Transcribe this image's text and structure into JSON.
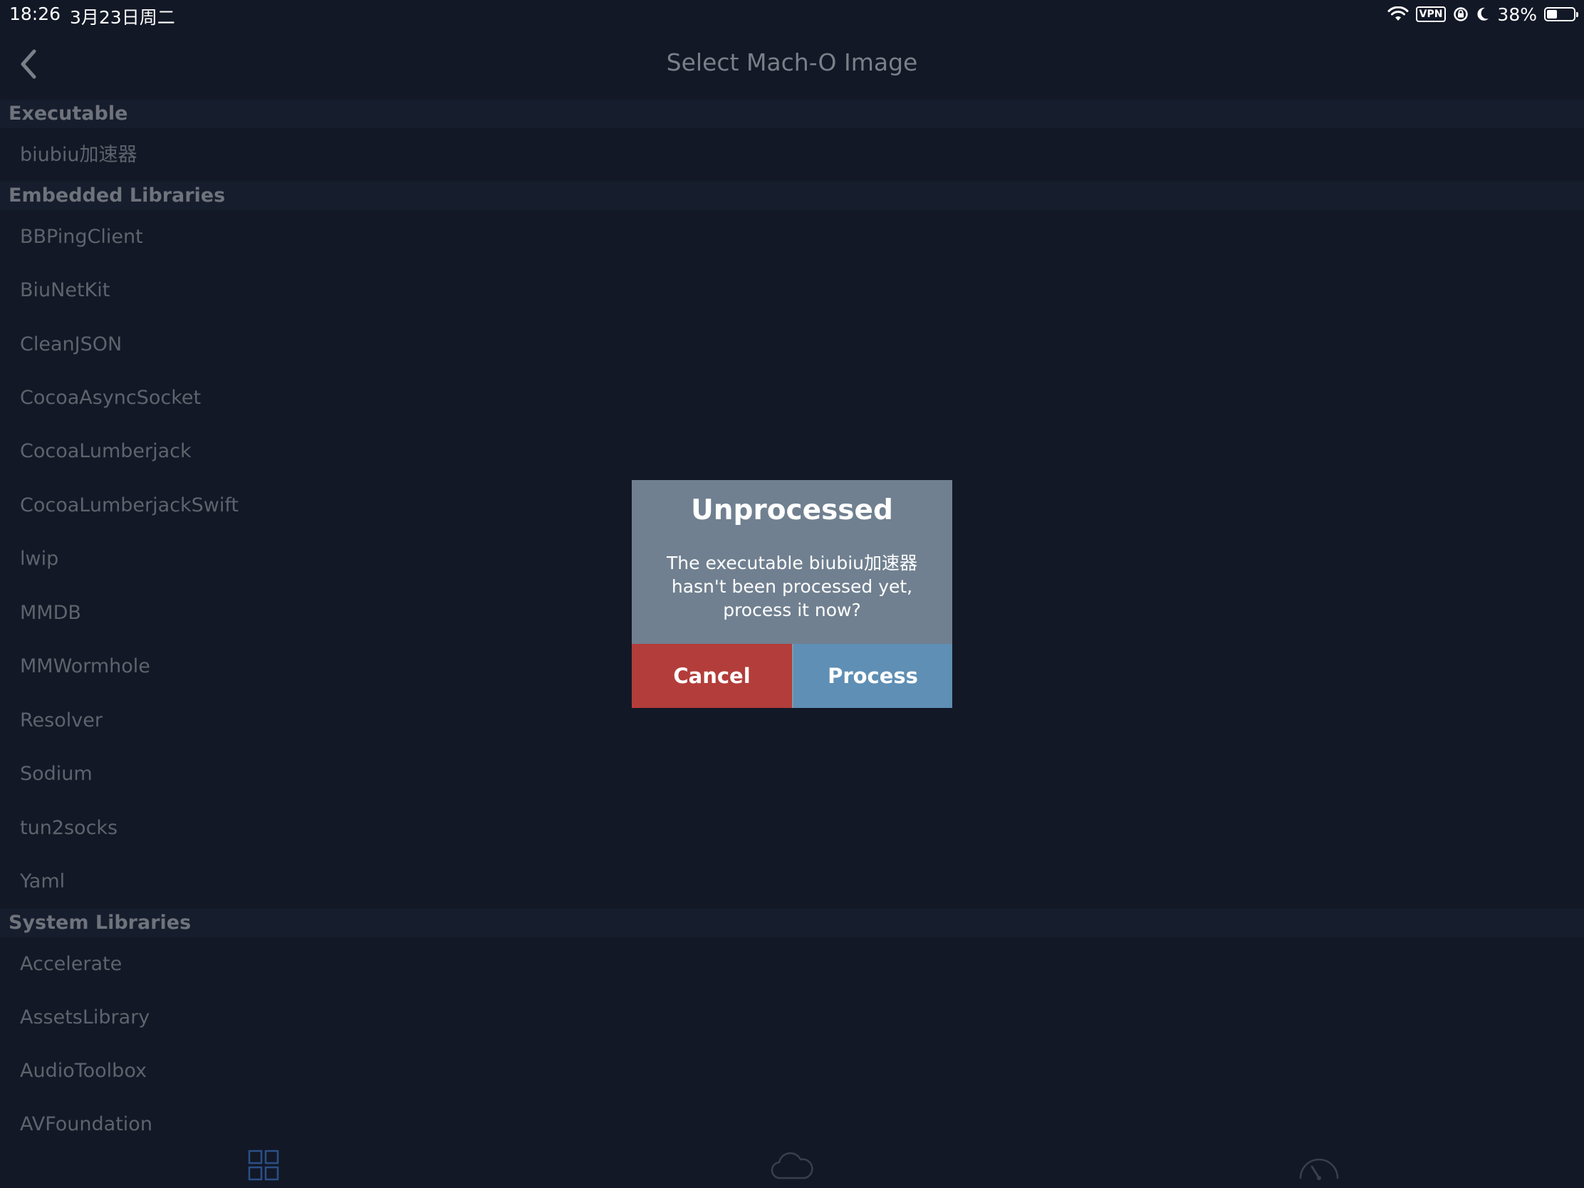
{
  "status_bar": {
    "time": "18:26",
    "date": "3月23日周二",
    "vpn": "VPN",
    "battery": "38%",
    "battery_level": 0.38
  },
  "nav": {
    "title": "Select Mach-O Image"
  },
  "sections": [
    {
      "header": "Executable",
      "items": [
        "biubiu加速器"
      ]
    },
    {
      "header": "Embedded Libraries",
      "items": [
        "BBPingClient",
        "BiuNetKit",
        "CleanJSON",
        "CocoaAsyncSocket",
        "CocoaLumberjack",
        "CocoaLumberjackSwift",
        "lwip",
        "MMDB",
        "MMWormhole",
        "Resolver",
        "Sodium",
        "tun2socks",
        "Yaml"
      ]
    },
    {
      "header": "System Libraries",
      "items": [
        "Accelerate",
        "AssetsLibrary",
        "AudioToolbox",
        "AVFoundation"
      ]
    }
  ],
  "alert": {
    "title": "Unprocessed",
    "message_lines": [
      "The executable biubiu加速器",
      "hasn't been processed yet,",
      "process it now?"
    ],
    "cancel_label": "Cancel",
    "process_label": "Process"
  },
  "tab_bar": {
    "tabs": [
      "grid-icon",
      "cloud-icon",
      "speedometer-icon"
    ]
  },
  "colors": {
    "background": "#121826",
    "alert_background": "#708090",
    "cancel": "#b33d3a",
    "process": "#5f8fb4",
    "active_tab": "#2b4f86"
  }
}
